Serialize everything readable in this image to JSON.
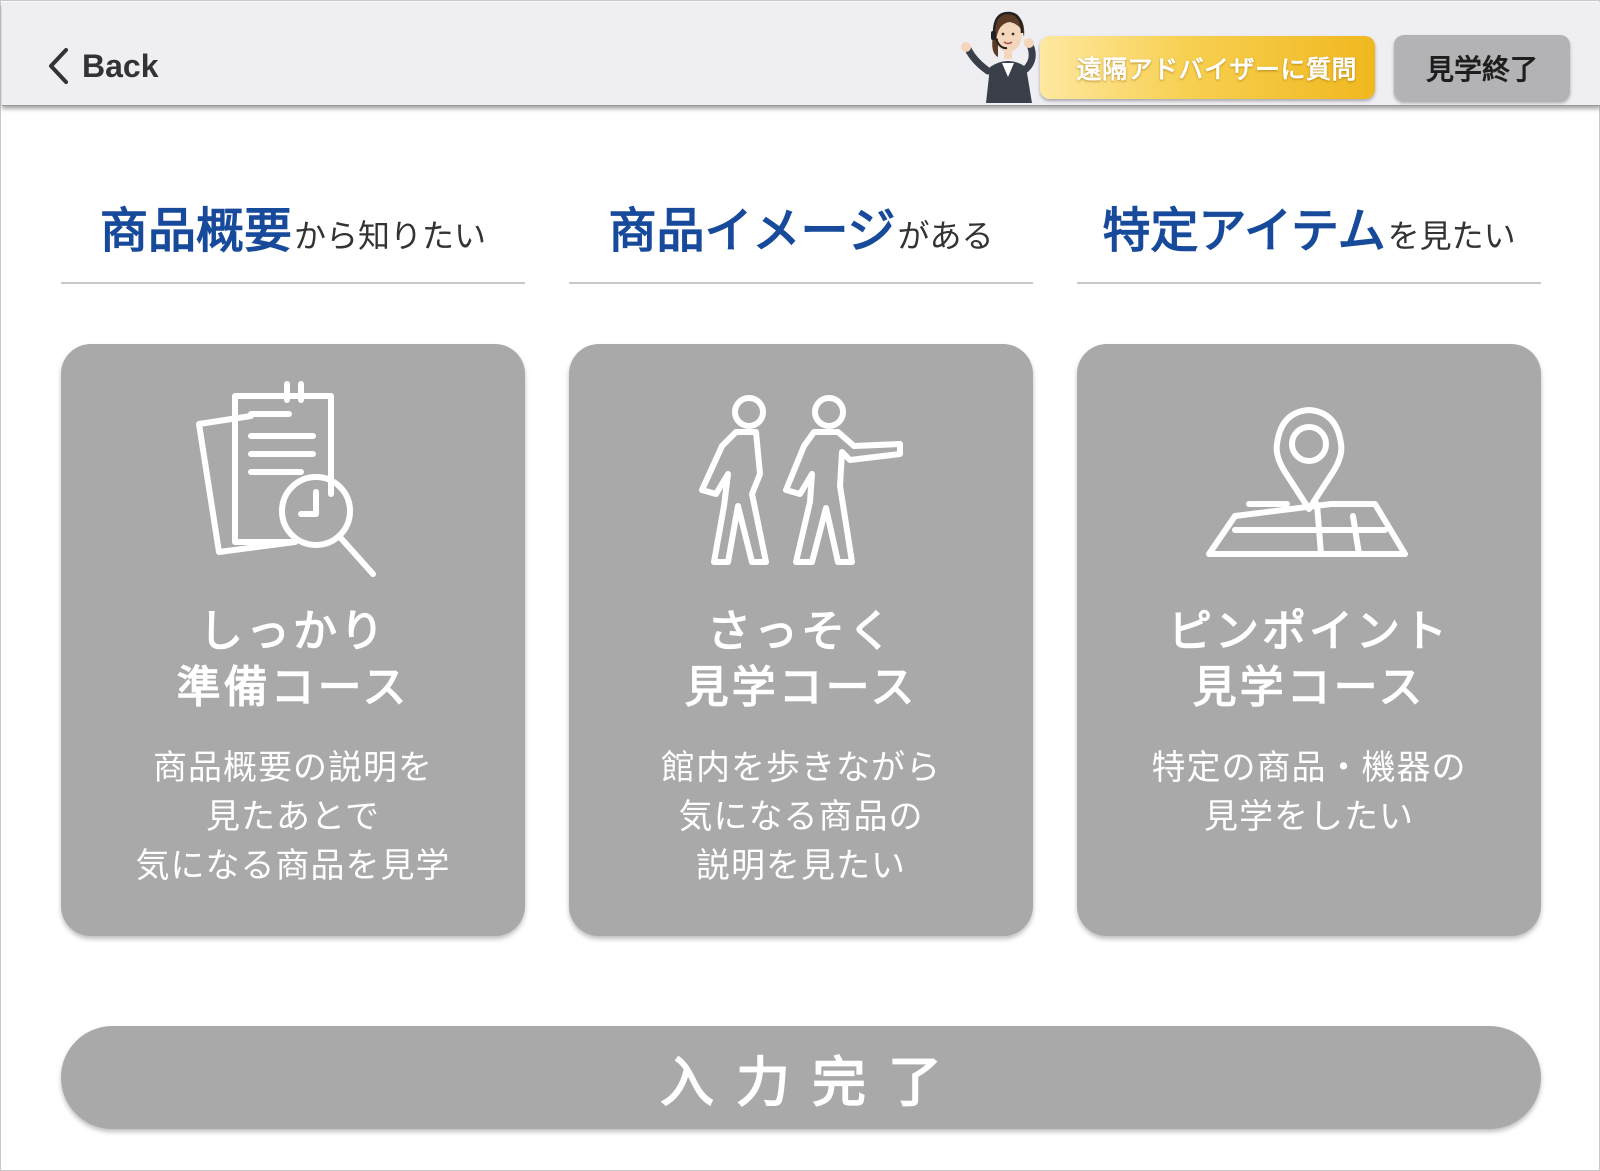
{
  "header": {
    "back_label": "Back",
    "advisor_label": "遠隔アドバイザーに質問",
    "end_label": "見学終了"
  },
  "columns": [
    {
      "heading_strong": "商品概要",
      "heading_weak": "から知りたい",
      "icon": "document-search-icon",
      "title_lines": [
        "しっかり",
        "準備コース"
      ],
      "desc_lines": [
        "商品概要の説明を",
        "見たあとで",
        "気になる商品を見学"
      ]
    },
    {
      "heading_strong": "商品イメージ",
      "heading_weak": "がある",
      "icon": "walking-people-icon",
      "title_lines": [
        "さっそく",
        "見学コース"
      ],
      "desc_lines": [
        "館内を歩きながら",
        "気になる商品の",
        "説明を見たい"
      ]
    },
    {
      "heading_strong": "特定アイテム",
      "heading_weak": "を見たい",
      "icon": "map-pin-icon",
      "title_lines": [
        "ピンポイント",
        "見学コース"
      ],
      "desc_lines": [
        "特定の商品・機器の",
        "見学をしたい"
      ]
    }
  ],
  "submit_label": "入力完了",
  "colors": {
    "heading_blue": "#174a9a",
    "card_gray": "#a9a9a9",
    "advisor_gold": "#f0b81f",
    "header_bg": "#efeef3"
  }
}
